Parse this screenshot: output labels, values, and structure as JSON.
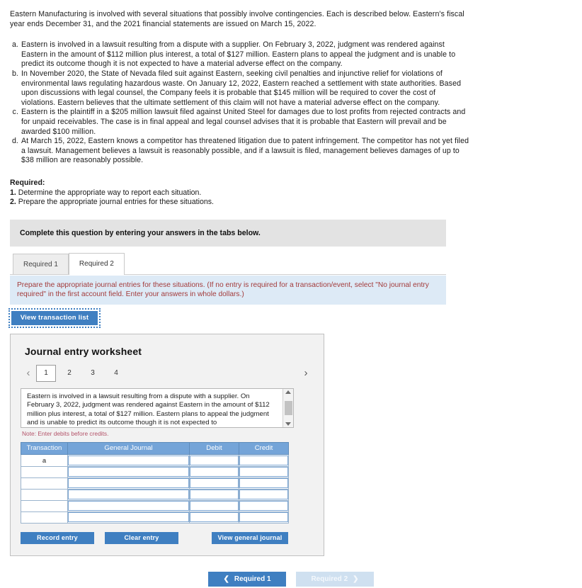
{
  "problem": {
    "intro": "Eastern Manufacturing is involved with several situations that possibly involve contingencies. Each is described below. Eastern's fiscal year ends December 31, and the 2021 financial statements are issued on March 15, 2022.",
    "situations": [
      {
        "letter": "a.",
        "text": "Eastern is involved in a lawsuit resulting from a dispute with a supplier. On February 3, 2022, judgment was rendered against Eastern in the amount of $112 million plus interest, a total of $127 million. Eastern plans to appeal the judgment and is unable to predict its outcome though it is not expected to have a material adverse effect on the company."
      },
      {
        "letter": "b.",
        "text": "In November 2020, the State of Nevada filed suit against Eastern, seeking civil penalties and injunctive relief for violations of environmental laws regulating hazardous waste. On January 12, 2022, Eastern reached a settlement with state authorities. Based upon discussions with legal counsel, the Company feels it is probable that $145 million will be required to cover the cost of violations. Eastern believes that the ultimate settlement of this claim will not have a material adverse effect on the company."
      },
      {
        "letter": "c.",
        "text": "Eastern is the plaintiff in a $205 million lawsuit filed against United Steel for damages due to lost profits from rejected contracts and for unpaid receivables. The case is in final appeal and legal counsel advises that it is probable that Eastern will prevail and be awarded $100 million."
      },
      {
        "letter": "d.",
        "text": "At March 15, 2022, Eastern knows a competitor has threatened litigation due to patent infringement. The competitor has not yet filed a lawsuit. Management believes a lawsuit is reasonably possible, and if a lawsuit is filed, management believes damages of up to $38 million are reasonably possible."
      }
    ],
    "required_title": "Required:",
    "required_items": [
      {
        "num": "1.",
        "text": "Determine the appropriate way to report each situation."
      },
      {
        "num": "2.",
        "text": "Prepare the appropriate journal entries for these situations."
      }
    ]
  },
  "banner": {
    "text": "Complete this question by entering your answers in the tabs below."
  },
  "tabs": [
    {
      "label": "Required 1",
      "active": false
    },
    {
      "label": "Required 2",
      "active": true
    }
  ],
  "instruction": {
    "text": "Prepare the appropriate journal entries for these situations. (If no entry is required for a transaction/event, select \"No journal entry required\" in the first account field. Enter your answers in whole dollars.)"
  },
  "view_transaction_list": {
    "label": "View transaction list"
  },
  "worksheet": {
    "title": "Journal entry worksheet",
    "pager": {
      "prev_icon": "chevron-left-icon",
      "next_icon": "chevron-right-icon",
      "pages": [
        "1",
        "2",
        "3",
        "4"
      ],
      "active_page": "1"
    },
    "description": "Eastern is involved in a lawsuit resulting from a dispute with a supplier. On February 3, 2022, judgment was rendered against Eastern in the amount of $112 million plus interest, a total of $127 million. Eastern plans to appeal the judgment and is unable to predict its outcome though it is not expected to",
    "note": "Note: Enter debits before credits.",
    "table": {
      "headers": [
        "Transaction",
        "General Journal",
        "Debit",
        "Credit"
      ],
      "rows": [
        {
          "transaction": "a",
          "general_journal": "",
          "debit": "",
          "credit": ""
        },
        {
          "transaction": "",
          "general_journal": "",
          "debit": "",
          "credit": ""
        },
        {
          "transaction": "",
          "general_journal": "",
          "debit": "",
          "credit": ""
        },
        {
          "transaction": "",
          "general_journal": "",
          "debit": "",
          "credit": ""
        },
        {
          "transaction": "",
          "general_journal": "",
          "debit": "",
          "credit": ""
        },
        {
          "transaction": "",
          "general_journal": "",
          "debit": "",
          "credit": ""
        }
      ]
    },
    "buttons": {
      "record_entry": "Record entry",
      "clear_entry": "Clear entry",
      "view_general_journal": "View general journal"
    }
  },
  "bottom_nav": {
    "prev_label": "Required 1",
    "next_label": "Required 2",
    "prev_icon": "chevron-left-icon",
    "next_icon": "chevron-right-icon"
  },
  "colors": {
    "accent_blue": "#3f7fc1",
    "table_header_blue": "#74a4d8",
    "instruction_bg": "#ddeaf6",
    "instruction_text": "#a33b3b",
    "note_text": "#b4546a",
    "banner_bg": "#e3e3e3",
    "panel_bg": "#f2f2f2",
    "disabled_blue": "#cfe0f0"
  }
}
